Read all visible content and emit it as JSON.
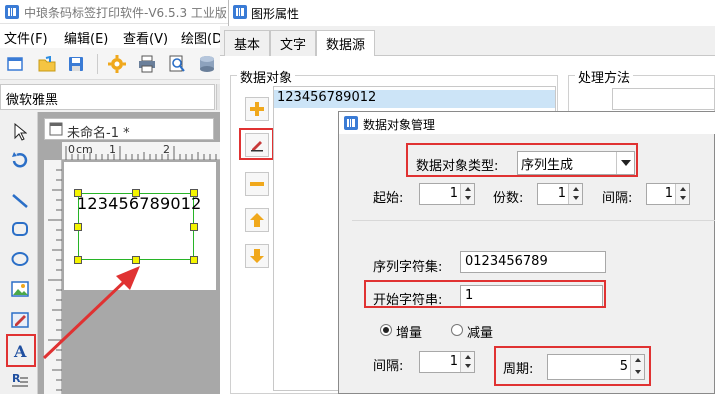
{
  "app": {
    "title": "中琅条码标签打印软件-V6.5.3 工业版",
    "menu": [
      "文件(F)",
      "编辑(E)",
      "查看(V)",
      "绘图(D"
    ],
    "font_name": "微软雅黑",
    "document_tab": "未命名-1 *",
    "ruler_unit": "cm",
    "ruler_marks": [
      "0",
      "1",
      "2"
    ],
    "barcode_text": "123456789012"
  },
  "graphic_props": {
    "title": "图形属性",
    "tabs": [
      "基本",
      "文字",
      "数据源"
    ],
    "active_tab": "数据源",
    "data_objects_label": "数据对象",
    "processing_label": "处理方法",
    "data_list": [
      "123456789012"
    ]
  },
  "data_object_dialog": {
    "title": "数据对象管理",
    "type_label": "数据对象类型:",
    "type_value": "序列生成",
    "start_label": "起始:",
    "start_value": "1",
    "copies_label": "份数:",
    "copies_value": "1",
    "interval_label": "间隔:",
    "interval_value": "1",
    "charset_label": "序列字符集:",
    "charset_value": "0123456789",
    "start_string_label": "开始字符串:",
    "start_string_value": "1",
    "increase_label": "增量",
    "decrease_label": "减量",
    "step_label": "间隔:",
    "step_value": "1",
    "cycle_label": "周期:",
    "cycle_value": "5"
  },
  "colors": {
    "highlight": "#e03232",
    "selection": "#27b427",
    "handle": "#f4f400"
  }
}
